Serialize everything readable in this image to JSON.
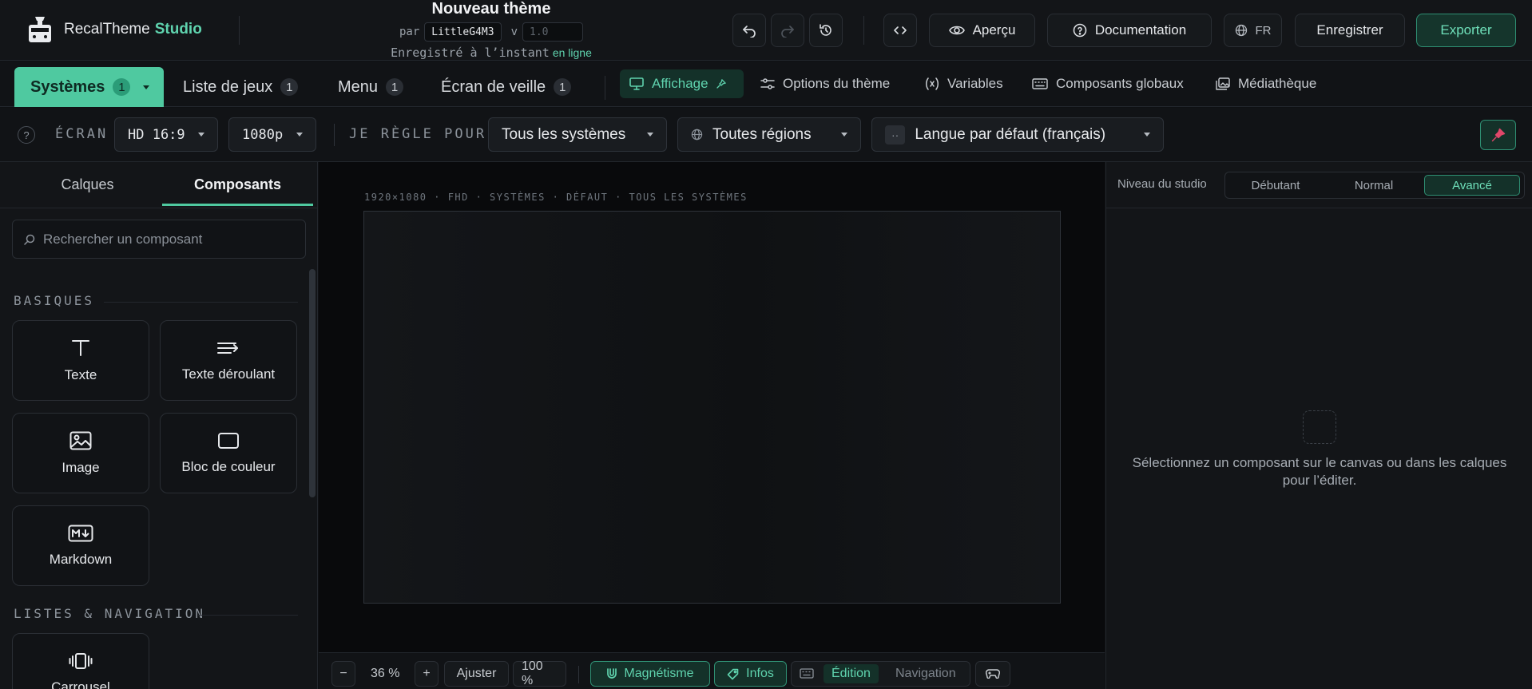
{
  "brand": {
    "name": "RecalTheme",
    "accent": "Studio",
    "logo_icon": "console-logo-icon"
  },
  "document": {
    "title": "Nouveau thème",
    "by_label": "par",
    "author": "LittleG4M3",
    "version_label": "v",
    "version_placeholder": "1.0",
    "save_status": "Enregistré à l’instant",
    "online_label": "en ligne"
  },
  "toolbar": {
    "undo_icon": "undo-icon",
    "redo_icon": "redo-icon",
    "history_icon": "history-icon",
    "code_icon": "code-icon",
    "preview_label": "Aperçu",
    "docs_label": "Documentation",
    "lang_label": "FR",
    "save_label": "Enregistrer",
    "export_label": "Exporter"
  },
  "main_tabs": [
    {
      "label": "Systèmes",
      "count": "1",
      "active": true
    },
    {
      "label": "Liste de jeux",
      "count": "1"
    },
    {
      "label": "Menu",
      "count": "1"
    },
    {
      "label": "Écran de veille",
      "count": "1"
    }
  ],
  "sub_tabs": [
    {
      "label": "Affichage",
      "active": true
    },
    {
      "label": "Options du thème"
    },
    {
      "label": "Variables"
    },
    {
      "label": "Composants globaux"
    },
    {
      "label": "Médiathèque"
    }
  ],
  "settings": {
    "help_glyph": "?",
    "screen_label": "ÉCRAN",
    "screen_value": "HD 16:9",
    "resolution_value": "1080p",
    "target_label": "JE RÈGLE POUR",
    "systems_value": "Tous les systèmes",
    "regions_value": "Toutes régions",
    "lang_badge": "··",
    "language_value": "Langue par défaut (français)"
  },
  "left_panel": {
    "tabs": [
      "Calques",
      "Composants"
    ],
    "active_tab": "Composants",
    "search_placeholder": "Rechercher un composant",
    "groups": [
      {
        "title": "BASIQUES",
        "items": [
          {
            "label": "Texte",
            "icon": "text-icon"
          },
          {
            "label": "Texte déroulant",
            "icon": "scrolling-text-icon"
          },
          {
            "label": "Image",
            "icon": "image-icon"
          },
          {
            "label": "Bloc de couleur",
            "icon": "color-block-icon"
          },
          {
            "label": "Markdown",
            "icon": "markdown-icon"
          }
        ]
      },
      {
        "title": "LISTES & NAVIGATION",
        "items": [
          {
            "label": "Carrousel",
            "icon": "carousel-icon"
          }
        ]
      }
    ]
  },
  "canvas": {
    "label": "1920×1080 · FHD · SYSTÈMES · DÉFAUT · TOUS LES SYSTÈMES"
  },
  "bottom_bar": {
    "zoom_out": "−",
    "zoom_value": "36 %",
    "zoom_in": "+",
    "fit_label": "Ajuster",
    "zoom_100": "100 %",
    "magnet_label": "Magnétisme",
    "info_label": "Infos",
    "mode_edit": "Édition",
    "mode_nav": "Navigation",
    "gamepad_icon": "gamepad-icon"
  },
  "right_panel": {
    "level_label": "Niveau du studio",
    "levels": [
      "Débutant",
      "Normal",
      "Avancé"
    ],
    "active_level": "Avancé",
    "empty_message": "Sélectionnez un composant sur le canvas ou dans les calques pour l’éditer."
  },
  "colors": {
    "accent": "#4fc9a0",
    "accent_text": "#5fd3ae",
    "background": "#0f1114",
    "pin": "#e0476a"
  }
}
